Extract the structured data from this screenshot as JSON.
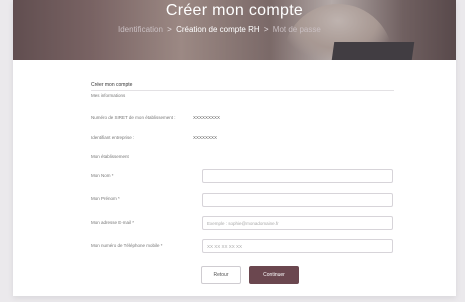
{
  "banner": {
    "title": "Créer mon compte",
    "breadcrumb": {
      "item1": "Identification",
      "sep1": ">",
      "item2": "Création de compte RH",
      "sep2": ">",
      "item3": "Mot de passe"
    }
  },
  "form": {
    "title": "Créer mon compte",
    "section_info": "Mes informations",
    "siret_label": "Numéro de SIRET de mon établissement :",
    "siret_value": "XXXXXXXXX",
    "id_label": "Identifiant entreprise :",
    "id_value": "XXXXXXXX",
    "section_etablissement": "Mon établissement",
    "nom_label": "Mon Nom *",
    "nom_value": "",
    "prenom_label": "Mon Prénom *",
    "prenom_value": "",
    "email_label": "Mon adresse E-mail *",
    "email_placeholder": "Exemple : sophie@monadomaine.fr",
    "phone_label": "Mon numéro de Téléphone mobile *",
    "phone_placeholder": "XX XX XX XX XX"
  },
  "actions": {
    "back_label": "Retour",
    "next_label": "Continuer"
  },
  "colors": {
    "primary": "#6b474f",
    "background": "#ebe9ec"
  }
}
